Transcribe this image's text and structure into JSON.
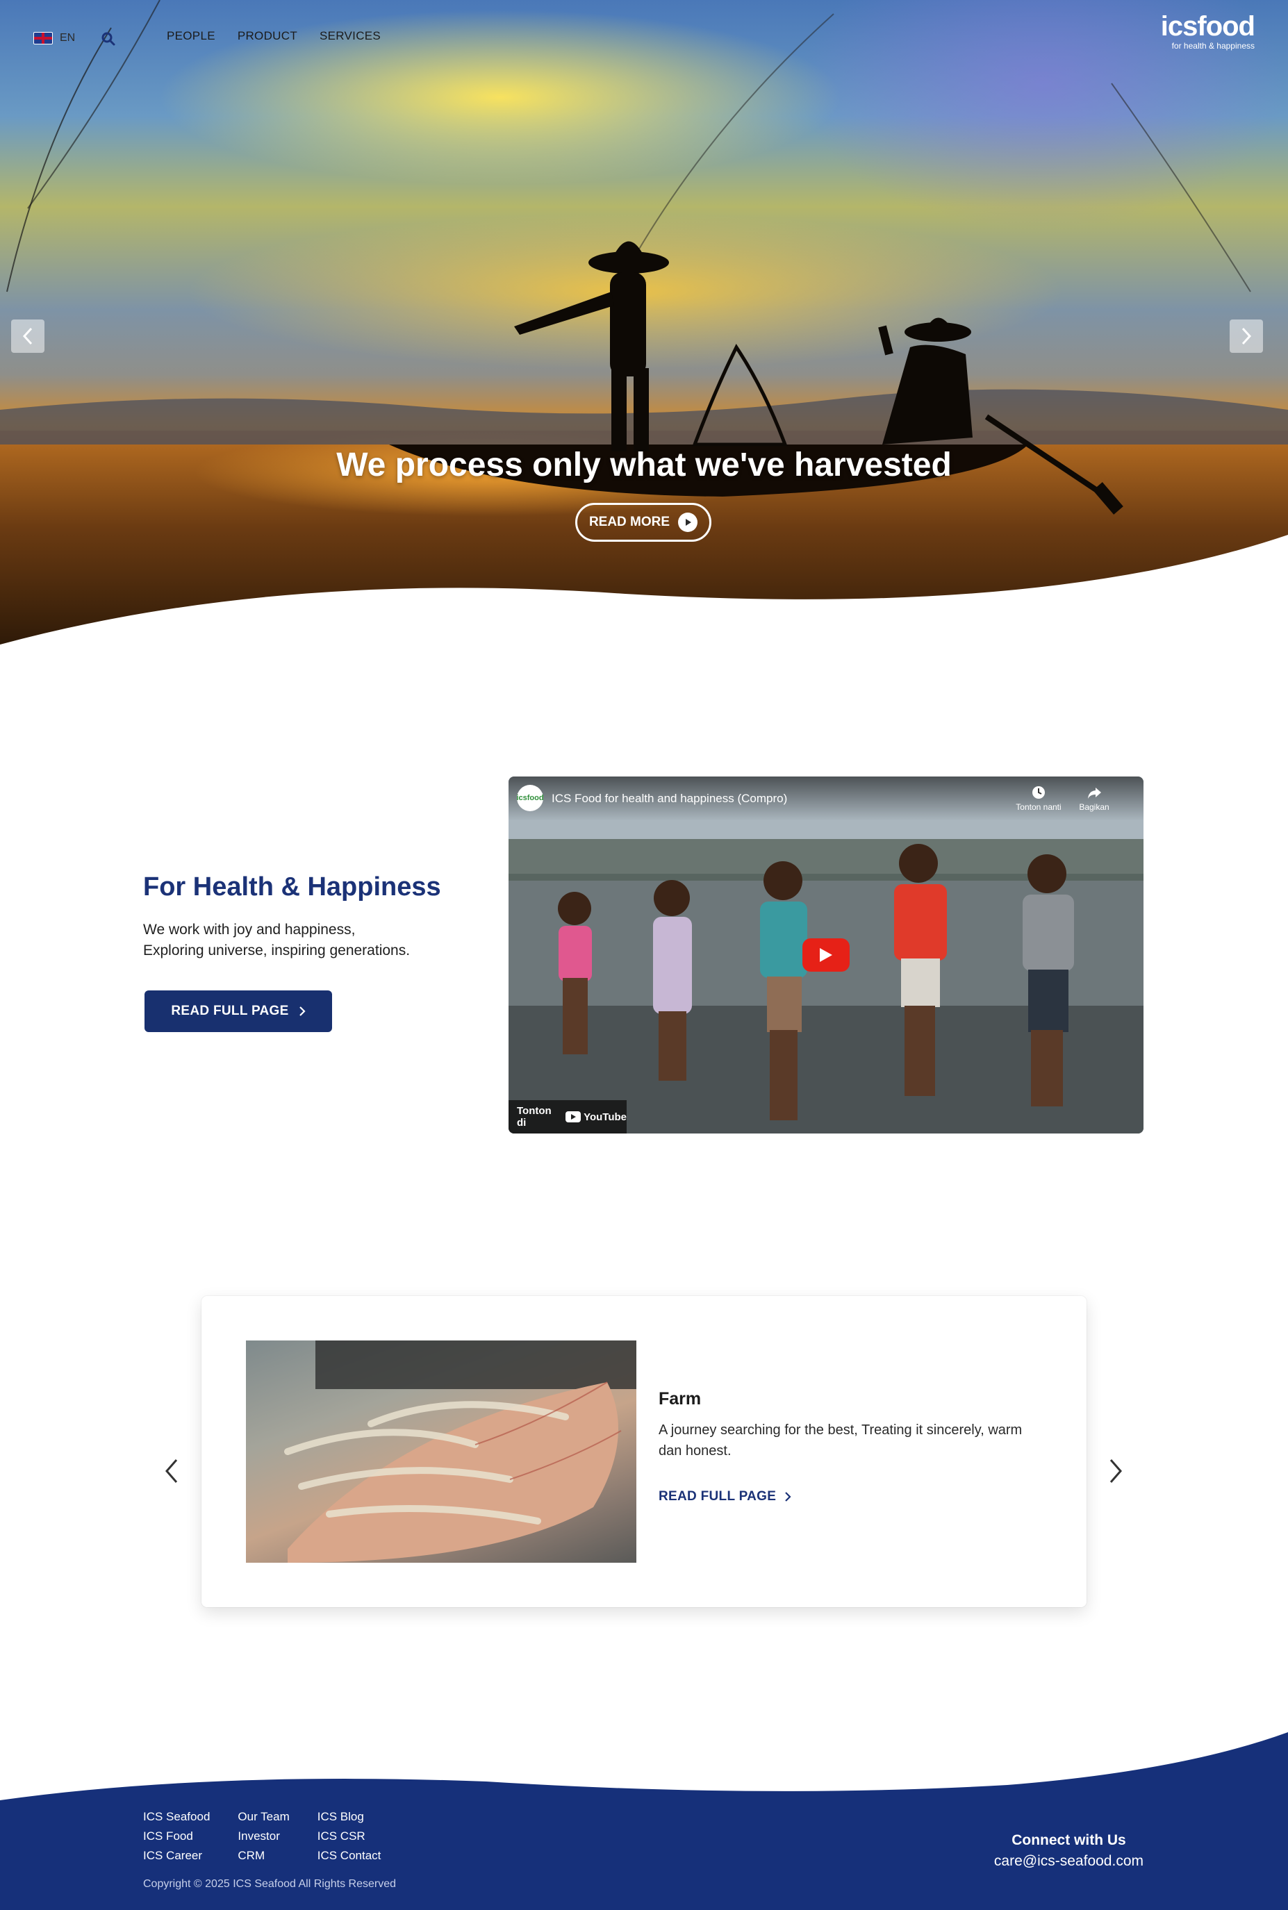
{
  "header": {
    "language": "EN",
    "nav": [
      "PEOPLE",
      "PRODUCT",
      "SERVICES"
    ],
    "logo_text": "icsfood",
    "logo_tagline": "for health & happiness"
  },
  "hero": {
    "title": "We process only what we've harvested",
    "button_label": "READ MORE"
  },
  "health": {
    "title": "For Health & Happiness",
    "line1": "We work with joy and happiness,",
    "line2": "Exploring universe, inspiring generations.",
    "button_label": "READ FULL PAGE"
  },
  "video": {
    "channel_avatar": "icsfood",
    "title": "ICS Food for health and happiness (Compro)",
    "watch_later": "Tonton nanti",
    "share": "Bagikan",
    "watch_on": "Tonton di",
    "youtube": "YouTube"
  },
  "carousel": {
    "title": "Farm",
    "text": "A journey searching for the best, Treating it sincerely, warm dan honest.",
    "link_label": "READ FULL PAGE"
  },
  "footer": {
    "col1": [
      "ICS Seafood",
      "ICS Food",
      "ICS Career"
    ],
    "col2": [
      "Our Team",
      "Investor",
      "CRM"
    ],
    "col3": [
      "ICS Blog",
      "ICS CSR",
      "ICS Contact"
    ],
    "copyright": "Copyright © 2025 ICS Seafood All Rights Reserved",
    "connect_title": "Connect with Us",
    "email": "care@ics-seafood.com"
  },
  "colors": {
    "brand_navy": "#18306f",
    "footer_navy": "#16307a",
    "youtube_red": "#e62117"
  }
}
